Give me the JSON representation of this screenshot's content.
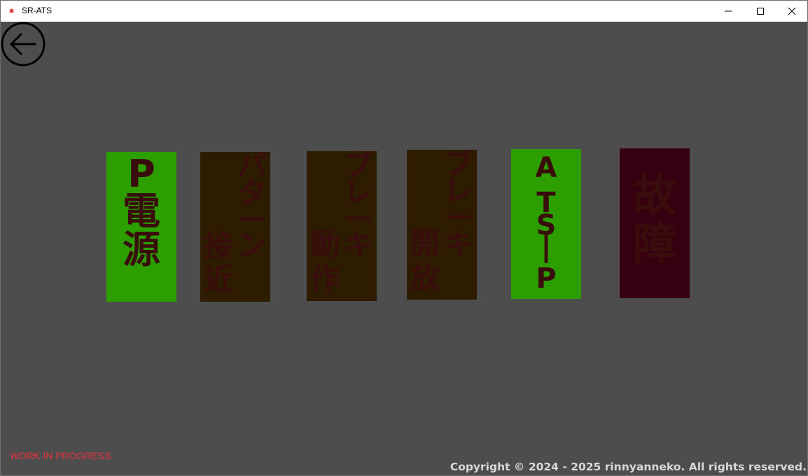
{
  "window": {
    "title": "SR-ATS",
    "app_icon_glyph": "☗",
    "controls": [
      "minimize-icon",
      "maximize-icon",
      "close-icon"
    ]
  },
  "back_button": {
    "icon": "arrow-left-circle-icon"
  },
  "lamps": [
    {
      "id": "p-power",
      "columns": [
        [
          "P",
          "電",
          "源"
        ]
      ],
      "state": "on",
      "color": "#2d9e00"
    },
    {
      "id": "pattern-approach",
      "columns": [
        [
          "パ",
          "タ",
          "ー",
          "ン"
        ],
        [
          "接",
          "近"
        ]
      ],
      "state": "off",
      "color": "#2e1c00"
    },
    {
      "id": "brake-applied",
      "columns": [
        [
          "ブ",
          "レ",
          "ー",
          "キ"
        ],
        [
          "動",
          "作"
        ]
      ],
      "state": "off",
      "color": "#2e1c00"
    },
    {
      "id": "brake-released",
      "columns": [
        [
          "ブ",
          "レ",
          "ー",
          "キ"
        ],
        [
          "開",
          "放"
        ]
      ],
      "state": "off",
      "color": "#2e1c00"
    },
    {
      "id": "ats-p",
      "columns": [
        [
          "A",
          "T",
          "S",
          "|",
          "P"
        ]
      ],
      "state": "on",
      "color": "#2d9e00"
    },
    {
      "id": "failure",
      "columns": [
        [
          "故",
          "障"
        ]
      ],
      "state": "off",
      "color": "#360010"
    }
  ],
  "footer": {
    "wip_text": "WORK IN PROGRESS",
    "copyright": "Copyright © 2024 - 2025 rinnyanneko. All rights reserved.",
    "wip_color": "#e8323c"
  }
}
